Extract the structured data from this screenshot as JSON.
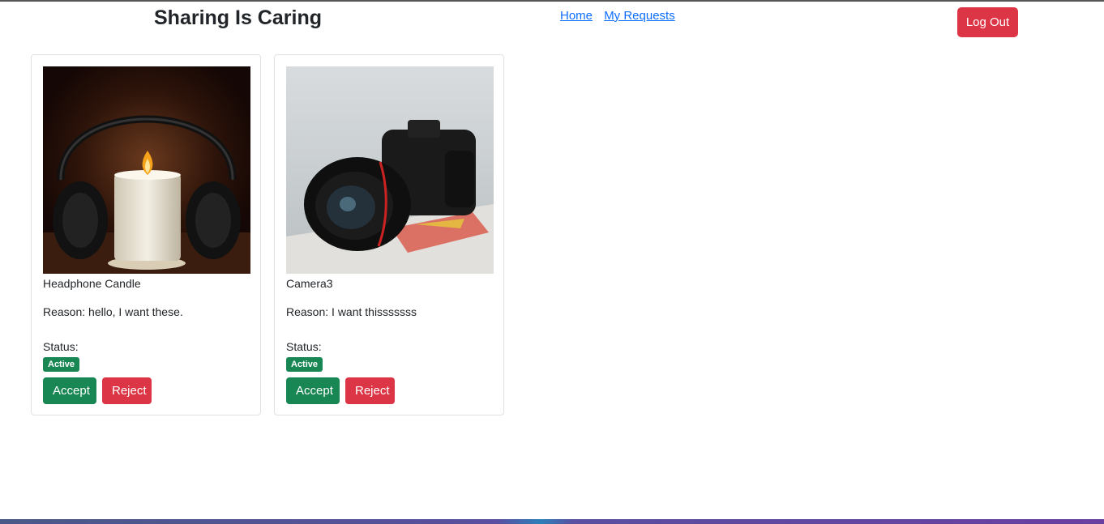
{
  "header": {
    "title": "Sharing Is Caring",
    "nav": [
      "Home",
      "My Requests"
    ],
    "logout_label": "Log Out"
  },
  "requests": [
    {
      "name": "Headphone Candle",
      "reason": "Reason: hello, I want these.",
      "status_label": "Status:",
      "status": "Active",
      "accept_label": "Accept",
      "reject_label": "Reject"
    },
    {
      "name": "Camera3",
      "reason": "Reason: I want thisssssss",
      "status_label": "Status:",
      "status": "Active",
      "accept_label": "Accept",
      "reject_label": "Reject"
    }
  ],
  "colors": {
    "accept": "#198754",
    "reject": "#dc3545",
    "link": "#0d6efd"
  }
}
